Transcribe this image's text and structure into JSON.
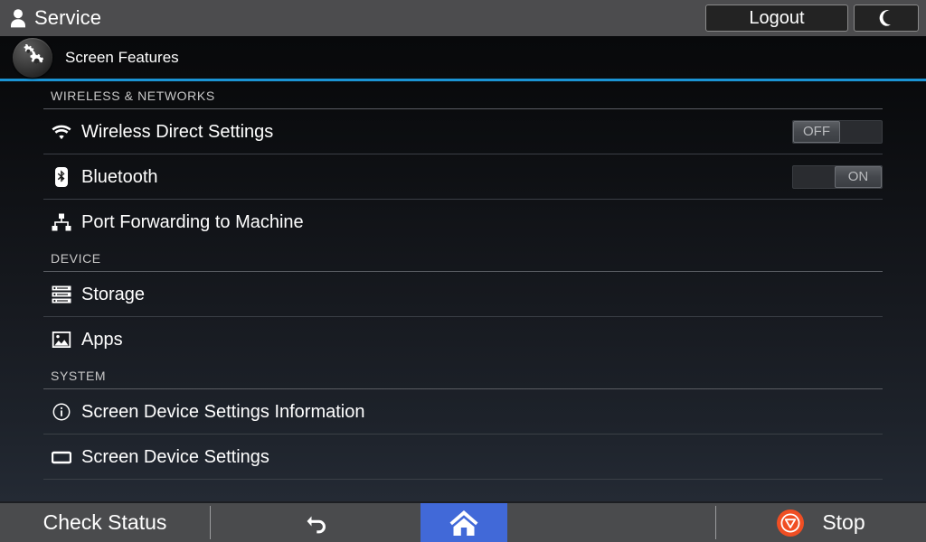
{
  "titlebar": {
    "user_icon": "user-icon",
    "title": "Service",
    "logout_label": "Logout",
    "moon_icon": "moon-icon"
  },
  "subheader": {
    "icon": "gears-icon",
    "title": "Screen Features",
    "accent_color": "#1b94d4"
  },
  "sections": [
    {
      "label": "WIRELESS & NETWORKS",
      "items": [
        {
          "icon": "wifi-icon",
          "label": "Wireless Direct Settings",
          "toggle": "OFF",
          "toggle_state": "off"
        },
        {
          "icon": "bluetooth-icon",
          "label": "Bluetooth",
          "toggle": "ON",
          "toggle_state": "on"
        },
        {
          "icon": "sitemap-icon",
          "label": "Port Forwarding to Machine"
        }
      ]
    },
    {
      "label": "DEVICE",
      "items": [
        {
          "icon": "storage-icon",
          "label": "Storage"
        },
        {
          "icon": "apps-image-icon",
          "label": "Apps"
        }
      ]
    },
    {
      "label": "SYSTEM",
      "items": [
        {
          "icon": "info-icon",
          "label": "Screen Device Settings Information"
        },
        {
          "icon": "display-icon",
          "label": "Screen Device Settings"
        }
      ]
    }
  ],
  "bottombar": {
    "check_status_label": "Check Status",
    "back_icon": "back-arrow-icon",
    "home_icon": "home-icon",
    "stop_icon": "stop-icon",
    "stop_label": "Stop",
    "home_highlight_color": "#4169d8",
    "stop_icon_color": "#f04e23"
  }
}
